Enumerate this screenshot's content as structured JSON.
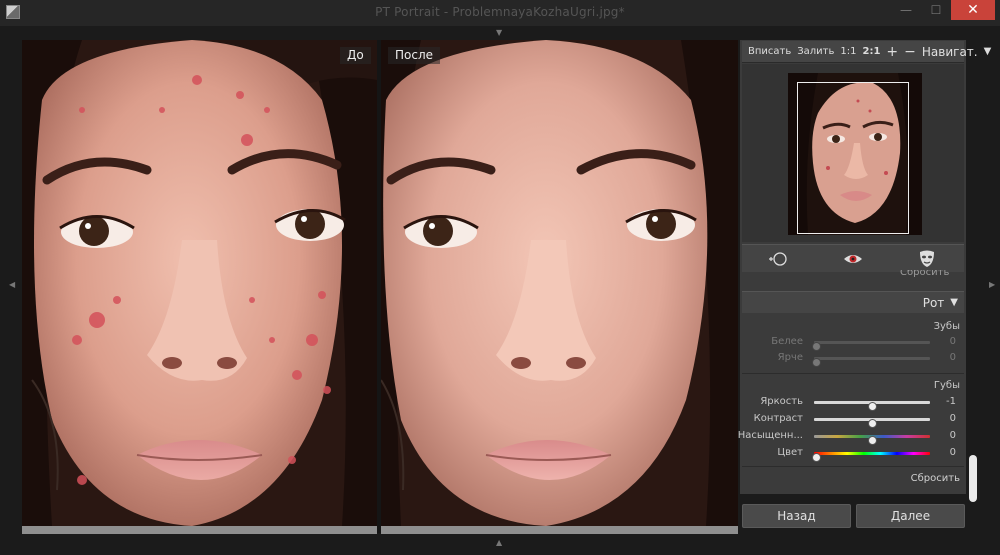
{
  "window": {
    "title": "PT Portrait - ProblemnayaKozhaUgri.jpg*",
    "min_glyph": "—",
    "max_glyph": "☐",
    "close_glyph": "✕"
  },
  "labels": {
    "before": "До",
    "after": "После"
  },
  "navigator": {
    "fit": "Вписать",
    "fill": "Залить",
    "zoom_1_1": "1:1",
    "zoom_2_1": "2:1",
    "zoom_in": "+",
    "zoom_out": "−",
    "title": "Навигат.",
    "dropdown_glyph": "▼"
  },
  "cut_text": "Сбросить",
  "mouth": {
    "title": "Рот",
    "dropdown_glyph": "▼",
    "teeth": {
      "title": "Зубы",
      "sliders": [
        {
          "label": "Белее",
          "value": "0",
          "position": 0.0
        },
        {
          "label": "Ярче",
          "value": "0",
          "position": 0.0
        }
      ]
    },
    "lips": {
      "title": "Губы",
      "sliders": [
        {
          "label": "Яркость",
          "value": "-1",
          "position": 0.5
        },
        {
          "label": "Контраст",
          "value": "0",
          "position": 0.5
        },
        {
          "label": "Насыщенн...",
          "value": "0",
          "position": 0.5
        },
        {
          "label": "Цвет",
          "value": "0",
          "position": 0.0
        }
      ]
    },
    "reset": "Сбросить"
  },
  "footer": {
    "back": "Назад",
    "next": "Далее"
  },
  "colors": {
    "window_bg": "#1b1b1b",
    "panel_bg": "#3b3b3b",
    "close_button": "#c9433a"
  }
}
